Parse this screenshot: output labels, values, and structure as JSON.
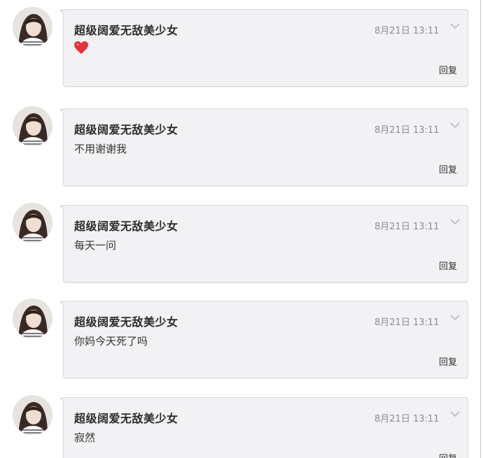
{
  "messages": [
    {
      "author": "超级阔爱无敌美少女",
      "time": "8月21日 13:11",
      "content": "",
      "content_type": "emoji-heart",
      "reply_label": "回复",
      "menu_icon": "chevron-down-icon",
      "avatar_icon": "avatar-girl"
    },
    {
      "author": "超级阔爱无敌美少女",
      "time": "8月21日 13:11",
      "content": "不用谢谢我",
      "reply_label": "回复",
      "menu_icon": "chevron-down-icon",
      "avatar_icon": "avatar-girl"
    },
    {
      "author": "超级阔爱无敌美少女",
      "time": "8月21日 13:11",
      "content": "每天一问",
      "reply_label": "回复",
      "menu_icon": "chevron-down-icon",
      "avatar_icon": "avatar-girl"
    },
    {
      "author": "超级阔爱无敌美少女",
      "time": "8月21日 13:11",
      "content": "你妈今天死了吗",
      "reply_label": "回复",
      "menu_icon": "chevron-down-icon",
      "avatar_icon": "avatar-girl"
    },
    {
      "author": "超级阔爱无敌美少女",
      "time": "8月21日 13:11",
      "content": "寂然",
      "reply_label": "回复",
      "menu_icon": "chevron-down-icon",
      "avatar_icon": "avatar-girl"
    }
  ],
  "colors": {
    "bubble_bg": "#f2f2f5",
    "bubble_border": "#d6d8dd",
    "name_text": "#2b2b2b",
    "time_text": "#8a8d93",
    "heart": "#e8303a"
  }
}
